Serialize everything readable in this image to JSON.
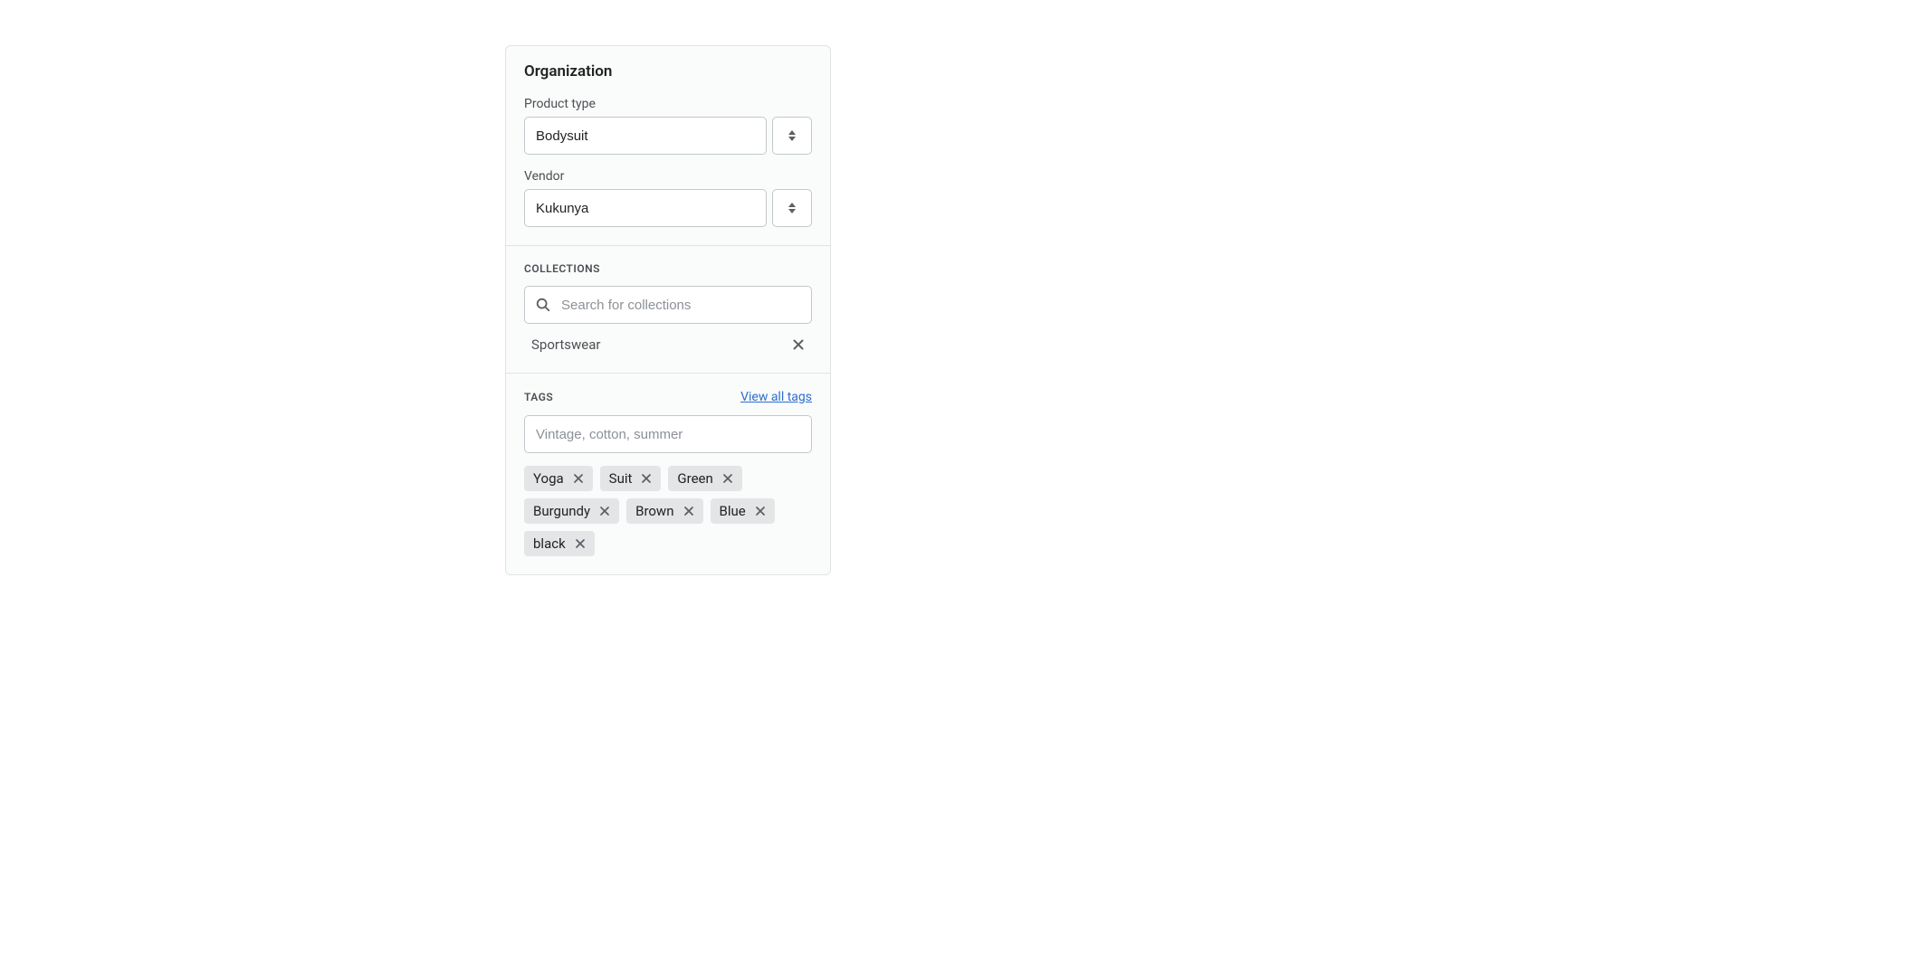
{
  "organization": {
    "title": "Organization",
    "product_type": {
      "label": "Product type",
      "value": "Bodysuit"
    },
    "vendor": {
      "label": "Vendor",
      "value": "Kukunya"
    }
  },
  "collections": {
    "heading": "COLLECTIONS",
    "search_placeholder": "Search for collections",
    "items": [
      {
        "name": "Sportswear"
      }
    ]
  },
  "tags": {
    "heading": "TAGS",
    "view_all_label": "View all tags",
    "input_placeholder": "Vintage, cotton, summer",
    "items": [
      {
        "name": "Yoga"
      },
      {
        "name": "Suit"
      },
      {
        "name": "Green"
      },
      {
        "name": "Burgundy"
      },
      {
        "name": "Brown"
      },
      {
        "name": "Blue"
      },
      {
        "name": "black"
      }
    ]
  }
}
